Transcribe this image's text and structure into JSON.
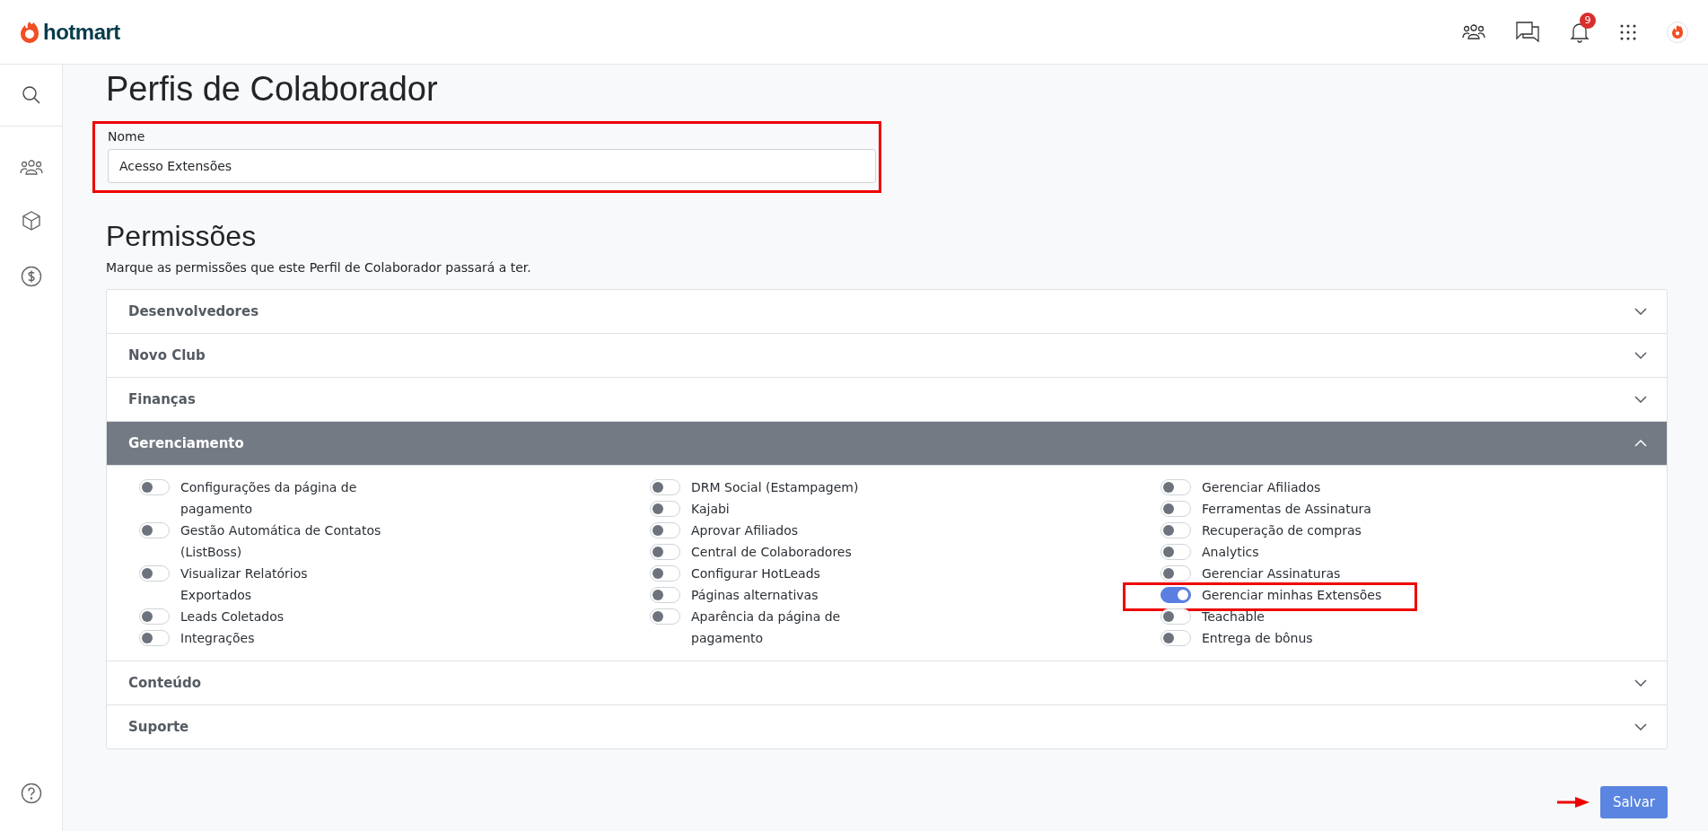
{
  "topbar": {
    "logo": "hotmart",
    "notifications": "9"
  },
  "page": {
    "title": "Perfis de Colaborador"
  },
  "name_field": {
    "label": "Nome",
    "value": "Acesso Extensões",
    "highlighted": true
  },
  "permissions": {
    "title": "Permissões",
    "description": "Marque as permissões que este Perfil de Colaborador passará a ter.",
    "sections": [
      {
        "title": "Desenvolvedores",
        "expanded": false
      },
      {
        "title": "Novo Club",
        "expanded": false
      },
      {
        "title": "Finanças",
        "expanded": false
      },
      {
        "title": "Gerenciamento",
        "expanded": true,
        "columns": [
          [
            {
              "label": "Configurações da página de pagamento",
              "on": false,
              "highlighted": false
            },
            {
              "label": "Gestão Automática de Contatos (ListBoss)",
              "on": false,
              "highlighted": false
            },
            {
              "label": "Visualizar Relatórios Exportados",
              "on": false,
              "highlighted": false
            },
            {
              "label": "Leads Coletados",
              "on": false,
              "highlighted": false
            },
            {
              "label": "Integrações",
              "on": false,
              "highlighted": false
            }
          ],
          [
            {
              "label": "DRM Social (Estampagem)",
              "on": false,
              "highlighted": false
            },
            {
              "label": "Kajabi",
              "on": false,
              "highlighted": false
            },
            {
              "label": "Aprovar Afiliados",
              "on": false,
              "highlighted": false
            },
            {
              "label": "Central de Colaboradores",
              "on": false,
              "highlighted": false
            },
            {
              "label": "Configurar HotLeads",
              "on": false,
              "highlighted": false
            },
            {
              "label": "Páginas alternativas",
              "on": false,
              "highlighted": false
            },
            {
              "label": "Aparência da página de pagamento",
              "on": false,
              "highlighted": false
            }
          ],
          [
            {
              "label": "Gerenciar Afiliados",
              "on": false,
              "highlighted": false
            },
            {
              "label": "Ferramentas de Assinatura",
              "on": false,
              "highlighted": false
            },
            {
              "label": "Recuperação de compras",
              "on": false,
              "highlighted": false
            },
            {
              "label": "Analytics",
              "on": false,
              "highlighted": false
            },
            {
              "label": "Gerenciar Assinaturas",
              "on": false,
              "highlighted": false
            },
            {
              "label": "Gerenciar minhas Extensões",
              "on": true,
              "highlighted": true
            },
            {
              "label": "Teachable",
              "on": false,
              "highlighted": false
            },
            {
              "label": "Entrega de bônus",
              "on": false,
              "highlighted": false
            }
          ]
        ]
      },
      {
        "title": "Conteúdo",
        "expanded": false
      },
      {
        "title": "Suporte",
        "expanded": false
      }
    ]
  },
  "save_button": {
    "label": "Salvar",
    "pointed": true
  }
}
